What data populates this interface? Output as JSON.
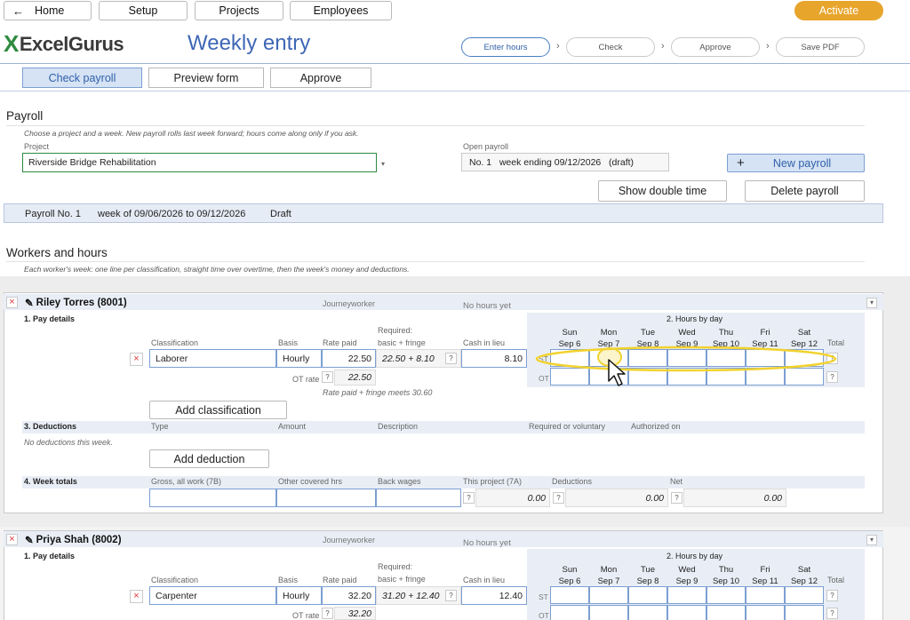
{
  "nav": {
    "back_icon": "arrow-left-icon",
    "home": "Home",
    "setup": "Setup",
    "projects": "Projects",
    "employees": "Employees",
    "activate": "Activate",
    "activate_color": "#e8a52c"
  },
  "brand": {
    "logo_mark": "X",
    "logo_text": "ExcelGurus",
    "page_title": "Weekly entry"
  },
  "steps": [
    "Enter hours",
    "Check",
    "Approve",
    "Save PDF"
  ],
  "subtabs": [
    "Check payroll",
    "Preview form",
    "Approve"
  ],
  "payroll": {
    "heading": "Payroll",
    "hint": "Choose a project and a week. New payroll rolls last week forward; hours come along only if you ask.",
    "project_label": "Project",
    "project_value": "Riverside Bridge Rehabilitation",
    "open_label": "Open payroll",
    "open_value": "No. 1   week ending 09/12/2026   (draft)",
    "new_payroll": "New payroll",
    "plus_icon": "plus-icon",
    "show_double_time": "Show double time",
    "delete_payroll": "Delete payroll",
    "status_no": "Payroll No. 1",
    "status_week": "week of 09/06/2026 to 09/12/2026",
    "status_state": "Draft"
  },
  "workers_section": {
    "heading": "Workers and hours",
    "hint": "Each worker's week: one line per classification, straight time over overtime, then the week's money and deductions."
  },
  "labels": {
    "pay_details": "1. Pay details",
    "hours_by_day": "2. Hours by day",
    "deductions": "3. Deductions",
    "week_totals": "4. Week totals",
    "classification": "Classification",
    "basis": "Basis",
    "rate_paid": "Rate paid",
    "required": "Required:",
    "basic_fringe": "basic + fringe",
    "cash_in_lieu": "Cash in lieu",
    "total": "Total",
    "st": "ST",
    "ot": "OT",
    "ot_rate": "OT rate",
    "journeyworker": "Journeyworker",
    "no_hours": "No hours yet",
    "q": "?",
    "add_classification": "Add classification",
    "add_deduction": "Add deduction",
    "no_deductions": "No deductions this week.",
    "type": "Type",
    "amount": "Amount",
    "description": "Description",
    "req_or_vol": "Required or voluntary",
    "authorized_on": "Authorized on",
    "gross": "Gross, all work (7B)",
    "other_hrs": "Other covered hrs",
    "back_wages": "Back wages",
    "this_project": "This project (7A)",
    "ded": "Deductions",
    "net": "Net"
  },
  "days": [
    {
      "d": "Sun",
      "date": "Sep 6"
    },
    {
      "d": "Mon",
      "date": "Sep 7"
    },
    {
      "d": "Tue",
      "date": "Sep 8"
    },
    {
      "d": "Wed",
      "date": "Sep 9"
    },
    {
      "d": "Thu",
      "date": "Sep 10"
    },
    {
      "d": "Fri",
      "date": "Sep 11"
    },
    {
      "d": "Sat",
      "date": "Sep 12"
    }
  ],
  "workers": [
    {
      "name": "Riley Torres (8001)",
      "classification": "Laborer",
      "basis": "Hourly",
      "rate": "22.50",
      "required": "22.50 + 8.10",
      "cash": "8.10",
      "ot_rate": "22.50",
      "note": "Rate paid + fringe meets 30.60",
      "this_project": "0.00",
      "deductions": "0.00",
      "net": "0.00"
    },
    {
      "name": "Priya Shah (8002)",
      "classification": "Carpenter",
      "basis": "Hourly",
      "rate": "32.20",
      "required": "31.20 + 12.40",
      "cash": "12.40",
      "ot_rate": "32.20"
    }
  ],
  "icons": {
    "edit": "pencil-icon",
    "remove": "close-icon",
    "dropdown": "chevron-down-icon",
    "cursor": "mouse-pointer-icon"
  },
  "colors": {
    "accent": "#3f67b5",
    "field_border": "#7c9fd2",
    "highlight": "#f2d22e"
  }
}
